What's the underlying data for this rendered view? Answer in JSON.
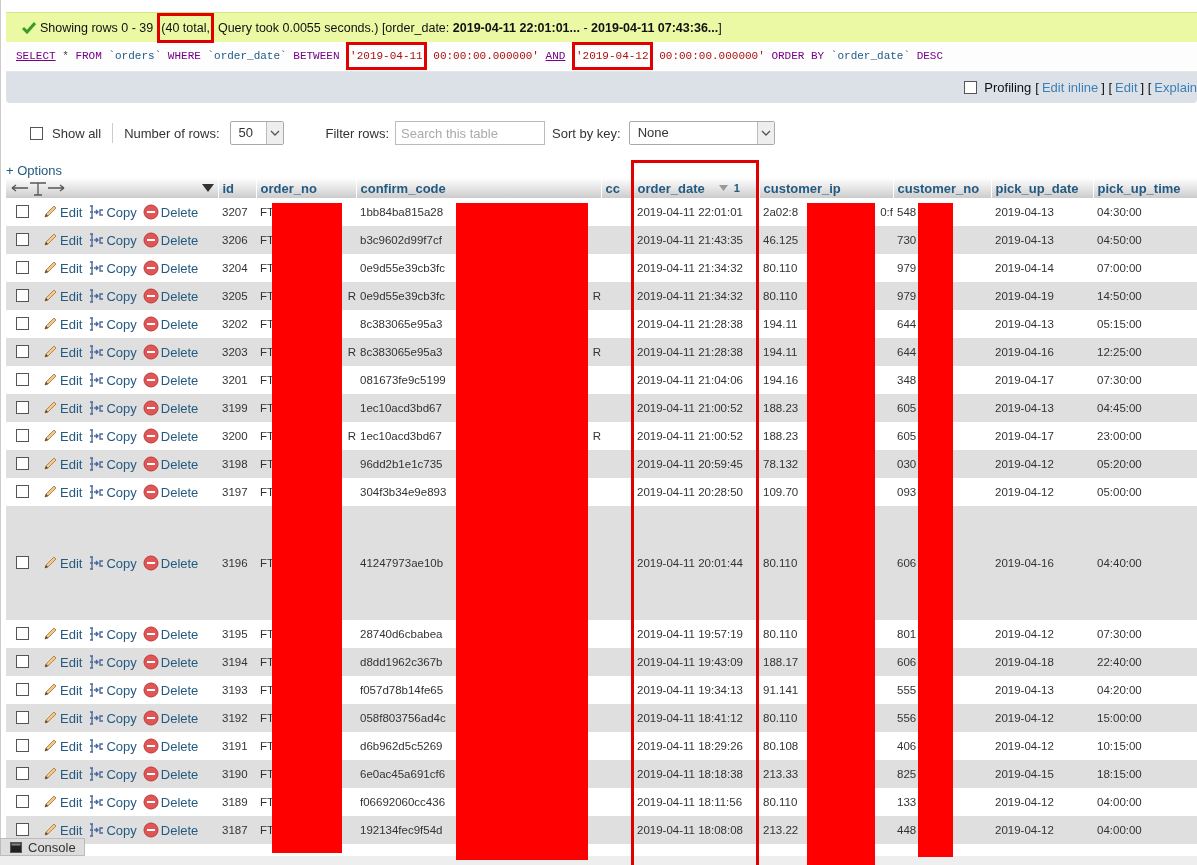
{
  "message": {
    "parts": [
      {
        "text": "Showing rows 0 - 39",
        "highlighted": false
      },
      {
        "text": "(40 total,",
        "highlighted": true
      },
      {
        "text": "Query took 0.0055 seconds.) [order_date: **2019-04-11 22:01:01...** - **2019-04-11 07:43:36...**]",
        "highlighted": false
      }
    ]
  },
  "sql": [
    {
      "kind": "link",
      "text": "SELECT",
      "highlighted": false
    },
    {
      "kind": "plain",
      "text": "* ",
      "highlighted": false
    },
    {
      "kind": "keyword",
      "text": "FROM ",
      "highlighted": false
    },
    {
      "kind": "ident",
      "text": "`orders` ",
      "highlighted": false
    },
    {
      "kind": "keyword",
      "text": "WHERE ",
      "highlighted": false
    },
    {
      "kind": "ident",
      "text": "`order_date` ",
      "highlighted": false
    },
    {
      "kind": "keyword",
      "text": "BETWEEN ",
      "highlighted": false
    },
    {
      "kind": "string",
      "text": "'2019-04-11",
      "highlighted": true
    },
    {
      "kind": "string",
      "text": " 00:00:00.000000' ",
      "highlighted": false
    },
    {
      "kind": "link",
      "text": "AND",
      "highlighted": false
    },
    {
      "kind": "string",
      "text": "'2019-04-12",
      "highlighted": true
    },
    {
      "kind": "string",
      "text": " 00:00:00.000000' ",
      "highlighted": false
    },
    {
      "kind": "keyword",
      "text": "ORDER BY ",
      "highlighted": false
    },
    {
      "kind": "ident",
      "text": "`order_date` ",
      "highlighted": false
    },
    {
      "kind": "keyword",
      "text": "DESC",
      "highlighted": false
    }
  ],
  "profiling": {
    "label": "Profiling",
    "checked": false,
    "parts": [
      {
        "kind": "text",
        "text": "["
      },
      {
        "kind": "link",
        "text": "Edit inline"
      },
      {
        "kind": "text",
        "text": "] ["
      },
      {
        "kind": "link",
        "text": "Edit"
      },
      {
        "kind": "text",
        "text": "] ["
      },
      {
        "kind": "link",
        "text": "Explain"
      }
    ]
  },
  "controls": {
    "show_all": {
      "label": "Show all",
      "checked": false
    },
    "rows_label": "Number of rows:",
    "rows_value": "50",
    "filter_label": "Filter rows:",
    "filter_placeholder": "Search this table",
    "sort_label": "Sort by key:",
    "sort_value": "None"
  },
  "options_link": "+ Options",
  "columns": [
    {
      "label": "id",
      "highlighted": false
    },
    {
      "label": "order_no",
      "highlighted": false
    },
    {
      "label": "confirm_code",
      "highlighted": false
    },
    {
      "label": "cc",
      "highlighted": false
    },
    {
      "label": "order_date",
      "descending": true,
      "sort_index": "1",
      "highlighted": true
    },
    {
      "label": "customer_ip",
      "highlighted": false
    },
    {
      "label": "customer_no",
      "highlighted": false
    },
    {
      "label": "pick_up_date",
      "highlighted": false
    },
    {
      "label": "pick_up_time",
      "highlighted": false
    }
  ],
  "rows": [
    {
      "checked": false,
      "tall": false,
      "edit": "Edit",
      "copy": "Copy",
      "delete": "Delete",
      "id": "3207",
      "order_no": "FT",
      "confirm_code": "1bb84ba815a28",
      "order_date": "2019-04-11 22:01:01",
      "customer_ip": "2a02:8",
      "customer_ip_end": "0:f",
      "customer_no": "548",
      "pick_up_date": "2019-04-13",
      "pick_up_time": "04:30:00"
    },
    {
      "checked": false,
      "tall": false,
      "edit": "Edit",
      "copy": "Copy",
      "delete": "Delete",
      "id": "3206",
      "order_no": "FT",
      "confirm_code": "b3c9602d99f7cf",
      "order_date": "2019-04-11 21:43:35",
      "customer_ip": "46.125",
      "customer_no": "730",
      "pick_up_date": "2019-04-13",
      "pick_up_time": "04:50:00"
    },
    {
      "checked": false,
      "tall": false,
      "edit": "Edit",
      "copy": "Copy",
      "delete": "Delete",
      "id": "3204",
      "order_no": "FT",
      "confirm_code": "0e9d55e39cb3fc",
      "order_date": "2019-04-11 21:34:32",
      "customer_ip": "80.110",
      "customer_no": "979",
      "pick_up_date": "2019-04-14",
      "pick_up_time": "07:00:00"
    },
    {
      "checked": false,
      "tall": false,
      "edit": "Edit",
      "copy": "Copy",
      "delete": "Delete",
      "id": "3205",
      "order_no": "FT",
      "order_no_end": "R",
      "confirm_code": "0e9d55e39cb3fc",
      "confirm_code_end": "R",
      "order_date": "2019-04-11 21:34:32",
      "customer_ip": "80.110",
      "customer_no": "979",
      "pick_up_date": "2019-04-19",
      "pick_up_time": "14:50:00"
    },
    {
      "checked": false,
      "tall": false,
      "edit": "Edit",
      "copy": "Copy",
      "delete": "Delete",
      "id": "3202",
      "order_no": "FT",
      "confirm_code": "8c383065e95a3",
      "order_date": "2019-04-11 21:28:38",
      "customer_ip": "194.11",
      "customer_no": "644",
      "pick_up_date": "2019-04-13",
      "pick_up_time": "05:15:00"
    },
    {
      "checked": false,
      "tall": false,
      "edit": "Edit",
      "copy": "Copy",
      "delete": "Delete",
      "id": "3203",
      "order_no": "FT",
      "order_no_end": "R",
      "confirm_code": "8c383065e95a3",
      "confirm_code_end": "R",
      "order_date": "2019-04-11 21:28:38",
      "customer_ip": "194.11",
      "customer_no": "644",
      "pick_up_date": "2019-04-16",
      "pick_up_time": "12:25:00"
    },
    {
      "checked": false,
      "tall": false,
      "edit": "Edit",
      "copy": "Copy",
      "delete": "Delete",
      "id": "3201",
      "order_no": "FT",
      "confirm_code": "081673fe9c5199",
      "order_date": "2019-04-11 21:04:06",
      "customer_ip": "194.16",
      "customer_no": "348",
      "pick_up_date": "2019-04-17",
      "pick_up_time": "07:30:00"
    },
    {
      "checked": false,
      "tall": false,
      "edit": "Edit",
      "copy": "Copy",
      "delete": "Delete",
      "id": "3199",
      "order_no": "FT",
      "confirm_code": "1ec10acd3bd67",
      "order_date": "2019-04-11 21:00:52",
      "customer_ip": "188.23",
      "customer_no": "605",
      "pick_up_date": "2019-04-13",
      "pick_up_time": "04:45:00"
    },
    {
      "checked": false,
      "tall": false,
      "edit": "Edit",
      "copy": "Copy",
      "delete": "Delete",
      "id": "3200",
      "order_no": "FT",
      "order_no_end": "R",
      "confirm_code": "1ec10acd3bd67",
      "confirm_code_end": "R",
      "order_date": "2019-04-11 21:00:52",
      "customer_ip": "188.23",
      "customer_no": "605",
      "pick_up_date": "2019-04-17",
      "pick_up_time": "23:00:00"
    },
    {
      "checked": false,
      "tall": false,
      "edit": "Edit",
      "copy": "Copy",
      "delete": "Delete",
      "id": "3198",
      "order_no": "FT",
      "confirm_code": "96dd2b1e1c735",
      "order_date": "2019-04-11 20:59:45",
      "customer_ip": "78.132",
      "customer_no": "030",
      "pick_up_date": "2019-04-12",
      "pick_up_time": "05:20:00"
    },
    {
      "checked": false,
      "tall": false,
      "edit": "Edit",
      "copy": "Copy",
      "delete": "Delete",
      "id": "3197",
      "order_no": "FT",
      "confirm_code": "304f3b34e9e893",
      "order_date": "2019-04-11 20:28:50",
      "customer_ip": "109.70",
      "customer_no": "093",
      "pick_up_date": "2019-04-12",
      "pick_up_time": "05:00:00"
    },
    {
      "checked": false,
      "tall": true,
      "edit": "Edit",
      "copy": "Copy",
      "delete": "Delete",
      "id": "3196",
      "order_no": "FT",
      "confirm_code": "41247973ae10b",
      "order_date": "2019-04-11 20:01:44",
      "customer_ip": "80.110",
      "customer_no": "606",
      "pick_up_date": "2019-04-16",
      "pick_up_time": "04:40:00"
    },
    {
      "checked": false,
      "tall": false,
      "edit": "Edit",
      "copy": "Copy",
      "delete": "Delete",
      "id": "3195",
      "order_no": "FT",
      "confirm_code": "28740d6cbabea",
      "order_date": "2019-04-11 19:57:19",
      "customer_ip": "80.110",
      "customer_no": "801",
      "pick_up_date": "2019-04-12",
      "pick_up_time": "07:30:00"
    },
    {
      "checked": false,
      "tall": false,
      "edit": "Edit",
      "copy": "Copy",
      "delete": "Delete",
      "id": "3194",
      "order_no": "FT",
      "confirm_code": "d8dd1962c367b",
      "order_date": "2019-04-11 19:43:09",
      "customer_ip": "188.17",
      "customer_no": "606",
      "pick_up_date": "2019-04-18",
      "pick_up_time": "22:40:00"
    },
    {
      "checked": false,
      "tall": false,
      "edit": "Edit",
      "copy": "Copy",
      "delete": "Delete",
      "id": "3193",
      "order_no": "FT",
      "confirm_code": "f057d78b14fe65",
      "order_date": "2019-04-11 19:34:13",
      "customer_ip": "91.141",
      "customer_no": "555",
      "pick_up_date": "2019-04-13",
      "pick_up_time": "04:20:00"
    },
    {
      "checked": false,
      "tall": false,
      "edit": "Edit",
      "copy": "Copy",
      "delete": "Delete",
      "id": "3192",
      "order_no": "FT",
      "confirm_code": "058f803756ad4c",
      "order_date": "2019-04-11 18:41:12",
      "customer_ip": "80.110",
      "customer_no": "556",
      "pick_up_date": "2019-04-12",
      "pick_up_time": "15:00:00"
    },
    {
      "checked": false,
      "tall": false,
      "edit": "Edit",
      "copy": "Copy",
      "delete": "Delete",
      "id": "3191",
      "order_no": "FT",
      "confirm_code": "d6b962d5c5269",
      "order_date": "2019-04-11 18:29:26",
      "customer_ip": "80.108",
      "customer_no": "406",
      "pick_up_date": "2019-04-12",
      "pick_up_time": "10:15:00"
    },
    {
      "checked": false,
      "tall": false,
      "edit": "Edit",
      "copy": "Copy",
      "delete": "Delete",
      "id": "3190",
      "order_no": "FT",
      "confirm_code": "6e0ac45a691cf6",
      "order_date": "2019-04-11 18:18:38",
      "customer_ip": "213.33",
      "customer_no": "825",
      "pick_up_date": "2019-04-15",
      "pick_up_time": "18:15:00"
    },
    {
      "checked": false,
      "tall": false,
      "edit": "Edit",
      "copy": "Copy",
      "delete": "Delete",
      "id": "3189",
      "order_no": "FT",
      "confirm_code": "f06692060cc436",
      "order_date": "2019-04-11 18:11:56",
      "customer_ip": "80.110",
      "customer_no": "133",
      "pick_up_date": "2019-04-12",
      "pick_up_time": "04:00:00"
    },
    {
      "checked": false,
      "tall": false,
      "edit": "Edit",
      "copy": "Copy",
      "delete": "Delete",
      "id": "3187",
      "order_no": "FT",
      "confirm_code": "192134fec9f54d",
      "order_date": "2019-04-11 18:08:08",
      "customer_ip": "213.22",
      "customer_no": "448",
      "pick_up_date": "2019-04-12",
      "pick_up_time": "04:00:00"
    }
  ],
  "console": {
    "label": "Console"
  }
}
